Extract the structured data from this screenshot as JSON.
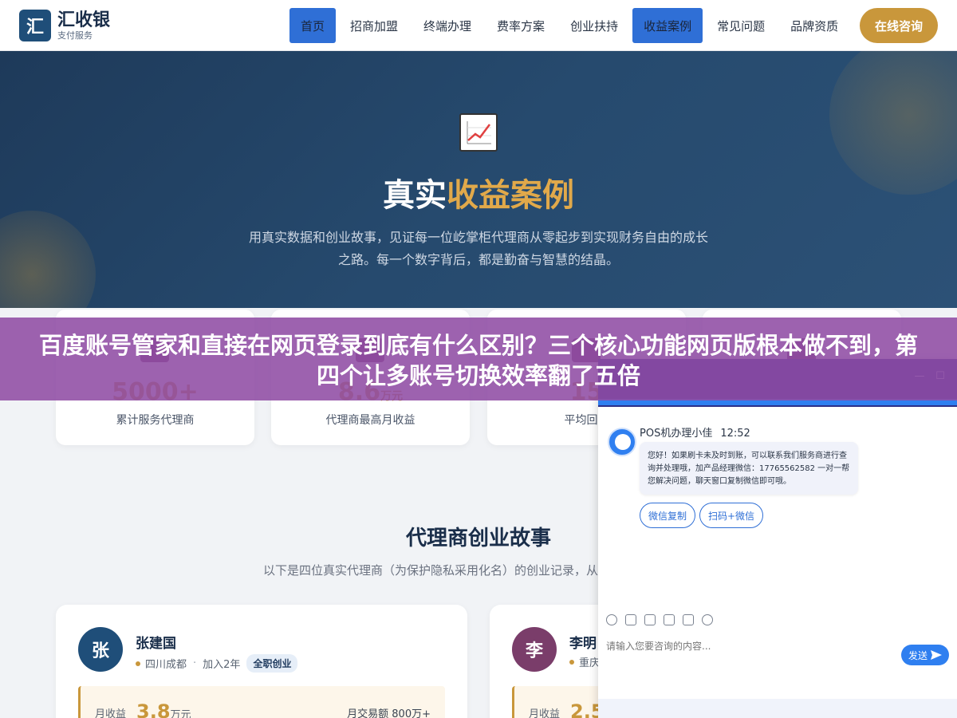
{
  "brand": {
    "mark": "汇",
    "name": "汇收银",
    "sub": "支付服务"
  },
  "nav": {
    "items": [
      "首页",
      "招商加盟",
      "终端办理",
      "费率方案",
      "创业扶持",
      "收益案例",
      "常见问题",
      "品牌资质"
    ],
    "active": [
      "首页",
      "收益案例"
    ],
    "consult": "在线咨询"
  },
  "hero": {
    "title_plain": "真实",
    "title_accent": "收益案例",
    "desc": "用真实数据和创业故事，见证每一位屹掌柜代理商从零起步到实现财务自由的成长之路。每一个数字背后，都是勤奋与智慧的结晶。"
  },
  "stats": [
    {
      "value": "5000+",
      "unit": "",
      "label": "累计服务代理商"
    },
    {
      "value": "8.6",
      "unit": "万元",
      "label": "代理商最高月收益"
    },
    {
      "value": "15",
      "unit": "",
      "label": "平均回本"
    },
    {
      "value": "",
      "unit": "",
      "label": ""
    }
  ],
  "banner": {
    "text": "百度账号管家和直接在网页登录到底有什么区别？三个核心功能网页版根本做不到，第四个让多账号切换效率翻了五倍"
  },
  "section": {
    "title": "代理商创业故事",
    "desc": "以下是四位真实代理商（为保护隐私采用化名）的创业记录，从个人奋斗到团队运"
  },
  "stories": [
    {
      "initial": "张",
      "name": "张建国",
      "location": "四川成都",
      "joined": "加入2年",
      "tag": "全职创业",
      "income_label": "月收益",
      "income_value": "3.8",
      "income_unit": "万元",
      "trade": "月交易额 800万+",
      "color": "#1f4e79"
    },
    {
      "initial": "李",
      "name": "李明",
      "location": "重庆",
      "joined": "",
      "tag": "",
      "income_label": "月收益",
      "income_value": "2.5",
      "income_unit": "",
      "trade": "",
      "color": "#7a3d6a"
    }
  ],
  "chat": {
    "min_icon": "—",
    "max_icon": "☐",
    "agent": "POS机办理小佳",
    "time": "12:52",
    "message": "您好！如果刷卡未及时到账，可以联系我们服务商进行查询并处理哦，加产品经理微信：17765562582 一对一帮您解决问题，聊天窗口复制微信即可哦。",
    "btn1": "微信复制",
    "btn2": "扫码+微信",
    "placeholder": "请输入您要咨询的内容...",
    "send": "发送"
  }
}
